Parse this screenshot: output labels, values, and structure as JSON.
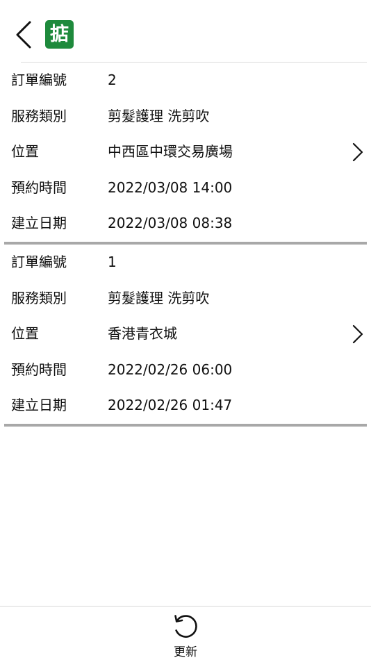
{
  "header": {
    "logo_text": "掂",
    "logo_color": "#1e8a3c"
  },
  "orders": [
    {
      "fields": [
        {
          "label": "訂單編號",
          "value": "2"
        },
        {
          "label": "服務類別",
          "value": "剪髮護理 洗剪吹"
        },
        {
          "label": "位置",
          "value": "中西區中環交易廣場",
          "has_chevron": true
        },
        {
          "label": "預約時間",
          "value": "2022/03/08 14:00"
        },
        {
          "label": "建立日期",
          "value": "2022/03/08 08:38"
        }
      ]
    },
    {
      "fields": [
        {
          "label": "訂單編號",
          "value": "1"
        },
        {
          "label": "服務類別",
          "value": "剪髮護理 洗剪吹"
        },
        {
          "label": "位置",
          "value": "香港青衣城",
          "has_chevron": true
        },
        {
          "label": "預約時間",
          "value": "2022/02/26 06:00"
        },
        {
          "label": "建立日期",
          "value": "2022/02/26 01:47"
        }
      ]
    }
  ],
  "footer": {
    "refresh_label": "更新",
    "refresh_icon": "refresh-icon"
  },
  "icons": {
    "back": "chevron-left-icon",
    "row_chevron": "chevron-right-icon"
  }
}
